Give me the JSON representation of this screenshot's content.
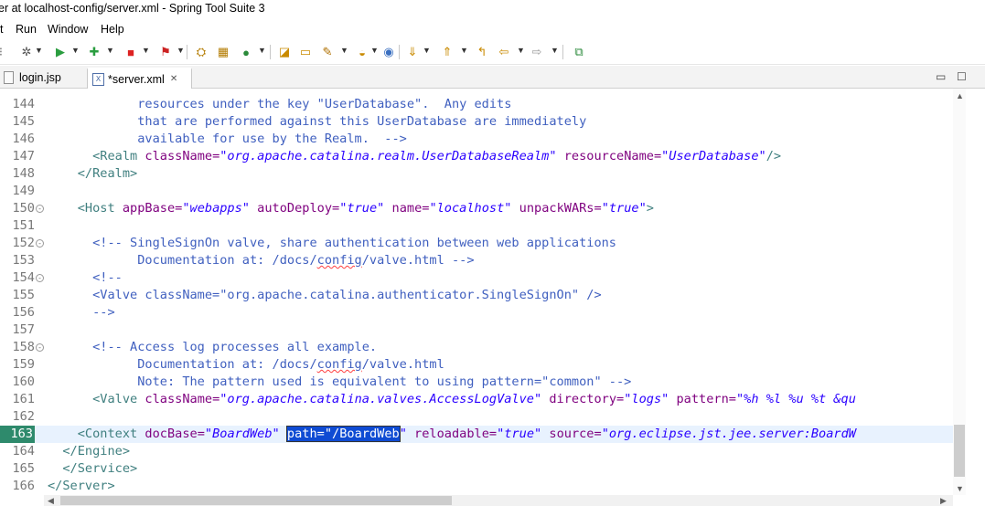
{
  "window": {
    "title": "er at localhost-config/server.xml - Spring Tool Suite 3"
  },
  "menu": [
    "t",
    "Run",
    "Window",
    "Help"
  ],
  "toolbar": {
    "icons": [
      "gear-icon",
      "run-icon",
      "debug-icon",
      "stop-icon",
      "coverage-icon",
      "new-java-project-icon",
      "new-package-icon",
      "new-class-icon",
      "open-type-icon",
      "open-task-icon",
      "search-icon",
      "annotation-icon",
      "globe-icon",
      "next-annotation-icon",
      "prev-annotation-icon",
      "last-edit-icon",
      "back-icon",
      "forward-icon",
      "pin-editor-icon"
    ]
  },
  "tabs": [
    {
      "label": "login.jsp",
      "active": false
    },
    {
      "label": "*server.xml",
      "active": true
    }
  ],
  "editor": {
    "current_line": "163",
    "lines": [
      {
        "n": "144",
        "fold": ""
      },
      {
        "n": "145",
        "fold": ""
      },
      {
        "n": "146",
        "fold": ""
      },
      {
        "n": "147",
        "fold": ""
      },
      {
        "n": "148",
        "fold": ""
      },
      {
        "n": "149",
        "fold": ""
      },
      {
        "n": "150",
        "fold": "⊖"
      },
      {
        "n": "151",
        "fold": ""
      },
      {
        "n": "152",
        "fold": "⊖"
      },
      {
        "n": "153",
        "fold": ""
      },
      {
        "n": "154",
        "fold": "⊖"
      },
      {
        "n": "155",
        "fold": ""
      },
      {
        "n": "156",
        "fold": ""
      },
      {
        "n": "157",
        "fold": ""
      },
      {
        "n": "158",
        "fold": "⊖"
      },
      {
        "n": "159",
        "fold": ""
      },
      {
        "n": "160",
        "fold": ""
      },
      {
        "n": "161",
        "fold": ""
      },
      {
        "n": "162",
        "fold": ""
      },
      {
        "n": "163",
        "fold": ""
      },
      {
        "n": "164",
        "fold": ""
      },
      {
        "n": "165",
        "fold": ""
      },
      {
        "n": "166",
        "fold": ""
      }
    ],
    "code": {
      "l144": "            resources under the key \"UserDatabase\".  Any edits",
      "l145": "            that are performed against this UserDatabase are immediately",
      "l146": "            available for use by the Realm.  -->",
      "l147_open": "      <Realm ",
      "l147_a1": "className=",
      "l147_v1": "\"org.apache.catalina.realm.UserDatabaseRealm\"",
      "l147_a2": " resourceName=",
      "l147_v2": "\"UserDatabase\"",
      "l147_close": "/>",
      "l148": "    </Realm>",
      "l150_open": "    <Host ",
      "l150_a1": "appBase=",
      "l150_v1": "\"webapps\"",
      "l150_a2": " autoDeploy=",
      "l150_v2": "\"true\"",
      "l150_a3": " name=",
      "l150_v3": "\"localhost\"",
      "l150_a4": " unpackWARs=",
      "l150_v4": "\"true\"",
      "l150_close": ">",
      "l152": "      <!-- SingleSignOn valve, share authentication between web applications",
      "l153_pre": "            Documentation at: /docs/",
      "l153_sq": "config",
      "l153_post": "/valve.html -->",
      "l154": "      <!--",
      "l155": "      <Valve className=\"org.apache.catalina.authenticator.SingleSignOn\" />",
      "l156": "      -->",
      "l158": "      <!-- Access log processes all example.",
      "l159_pre": "            Documentation at: /docs/",
      "l159_sq": "config",
      "l159_post": "/valve.html",
      "l160": "            Note: The pattern used is equivalent to using pattern=\"common\" -->",
      "l161_open": "      <Valve ",
      "l161_a1": "className=",
      "l161_v1": "\"org.apache.catalina.valves.AccessLogValve\"",
      "l161_a2": " directory=",
      "l161_v2": "\"logs\"",
      "l161_a3": " pattern=",
      "l161_v3": "\"%h %l %u %t &qu",
      "l163_open": "    <Context ",
      "l163_a1": "docBase=",
      "l163_v1": "\"BoardWeb\"",
      "l163_sp": " ",
      "l163_sel": "path=\"/BoardWeb",
      "l163_v2end": "\"",
      "l163_a3": " reloadable=",
      "l163_v3": "\"true\"",
      "l163_a4": " source=",
      "l163_v4": "\"org.eclipse.jst.jee.server:BoardW",
      "l164": "  </Engine>",
      "l165": "  </Service>",
      "l166": "</Server>"
    }
  },
  "window_controls": {
    "minimize": "▭",
    "maximize": "☐"
  }
}
